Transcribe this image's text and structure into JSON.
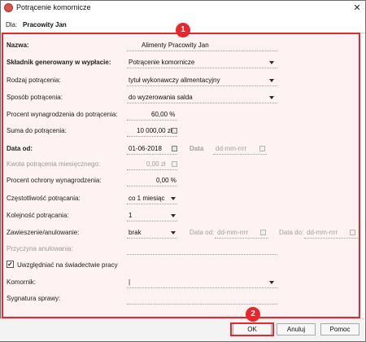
{
  "window": {
    "title": "Potrącenie komornicze",
    "close_glyph": "✕"
  },
  "header": {
    "for_label": "Dla:",
    "for_value": "Pracowity Jan"
  },
  "badges": {
    "first": "1",
    "second": "2"
  },
  "form": {
    "name": {
      "label": "Nazwa:",
      "value": "Alimenty Pracowity Jan"
    },
    "component": {
      "label": "Składnik generowany w wypłacie:",
      "value": "Potrącenie komornicze"
    },
    "deduction_type": {
      "label": "Rodzaj potrącenia:",
      "value": "tytuł wykonawczy alimentacyjny"
    },
    "deduction_method": {
      "label": "Sposób potrącenia:",
      "value": "do wyzerowania salda"
    },
    "salary_percent": {
      "label": "Procent wynagrodzenia do potrącenia:",
      "value": "60,00 %"
    },
    "total_amount": {
      "label": "Suma do potrącenia:",
      "value": "10 000,00 zł"
    },
    "date_from": {
      "label": "Data od:",
      "value": "01-06-2018",
      "to_label": "Data",
      "to_placeholder": "dd-mm-rrrr"
    },
    "monthly_amount": {
      "label": "Kwota potrącenia miesięcznego:",
      "value": "0,00 zł"
    },
    "protection_percent": {
      "label": "Procent ochrony wynagrodzenia:",
      "value": "0,00 %"
    },
    "frequency": {
      "label": "Częstotliwość potrącania:",
      "value": "co 1 miesiąc"
    },
    "order": {
      "label": "Kolejność potrącania:",
      "value": "1"
    },
    "suspension": {
      "label": "Zawieszenie/anulowanie:",
      "value": "brak",
      "date_from_label": "Data od:",
      "date_from_placeholder": "dd-mm-rrrr",
      "date_to_label": "Data do:",
      "date_to_placeholder": "dd-mm-rrrr"
    },
    "cancel_reason": {
      "label": "Przyczyna anulowania:",
      "value": ""
    },
    "include_certificate": {
      "label": "Uwzględniać na świadectwie pracy",
      "checked": true,
      "check_glyph": "✓"
    },
    "bailiff": {
      "label": "Komornik:",
      "value": "|"
    },
    "case_signature": {
      "label": "Sygnatura sprawy:",
      "value": ""
    }
  },
  "buttons": {
    "ok": "OK",
    "cancel": "Anuluj",
    "help": "Pomoc"
  },
  "colors": {
    "highlight": "#e8262e",
    "highlight_fill": "#ffd7d7"
  },
  "icons": {
    "app": "app-logo-icon",
    "calendar": "calendar-icon",
    "dropdown": "chevron-down-icon",
    "close": "close-icon"
  }
}
